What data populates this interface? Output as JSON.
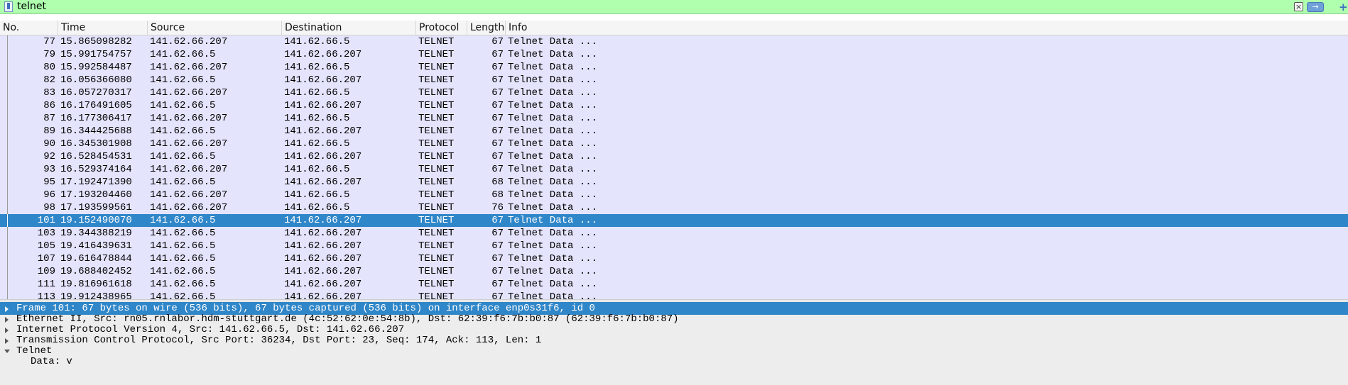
{
  "filter": {
    "value": "telnet",
    "clear_label": "×",
    "apply_label": "→",
    "add_label": "+"
  },
  "columns": [
    "No.",
    "Time",
    "Source",
    "Destination",
    "Protocol",
    "Length",
    "Info"
  ],
  "packets": [
    {
      "no": "77",
      "time": "15.865098282",
      "src": "141.62.66.207",
      "dst": "141.62.66.5",
      "proto": "TELNET",
      "len": "67",
      "info": "Telnet Data ..."
    },
    {
      "no": "79",
      "time": "15.991754757",
      "src": "141.62.66.5",
      "dst": "141.62.66.207",
      "proto": "TELNET",
      "len": "67",
      "info": "Telnet Data ..."
    },
    {
      "no": "80",
      "time": "15.992584487",
      "src": "141.62.66.207",
      "dst": "141.62.66.5",
      "proto": "TELNET",
      "len": "67",
      "info": "Telnet Data ..."
    },
    {
      "no": "82",
      "time": "16.056366080",
      "src": "141.62.66.5",
      "dst": "141.62.66.207",
      "proto": "TELNET",
      "len": "67",
      "info": "Telnet Data ..."
    },
    {
      "no": "83",
      "time": "16.057270317",
      "src": "141.62.66.207",
      "dst": "141.62.66.5",
      "proto": "TELNET",
      "len": "67",
      "info": "Telnet Data ..."
    },
    {
      "no": "86",
      "time": "16.176491605",
      "src": "141.62.66.5",
      "dst": "141.62.66.207",
      "proto": "TELNET",
      "len": "67",
      "info": "Telnet Data ..."
    },
    {
      "no": "87",
      "time": "16.177306417",
      "src": "141.62.66.207",
      "dst": "141.62.66.5",
      "proto": "TELNET",
      "len": "67",
      "info": "Telnet Data ..."
    },
    {
      "no": "89",
      "time": "16.344425688",
      "src": "141.62.66.5",
      "dst": "141.62.66.207",
      "proto": "TELNET",
      "len": "67",
      "info": "Telnet Data ..."
    },
    {
      "no": "90",
      "time": "16.345301908",
      "src": "141.62.66.207",
      "dst": "141.62.66.5",
      "proto": "TELNET",
      "len": "67",
      "info": "Telnet Data ..."
    },
    {
      "no": "92",
      "time": "16.528454531",
      "src": "141.62.66.5",
      "dst": "141.62.66.207",
      "proto": "TELNET",
      "len": "67",
      "info": "Telnet Data ..."
    },
    {
      "no": "93",
      "time": "16.529374164",
      "src": "141.62.66.207",
      "dst": "141.62.66.5",
      "proto": "TELNET",
      "len": "67",
      "info": "Telnet Data ..."
    },
    {
      "no": "95",
      "time": "17.192471390",
      "src": "141.62.66.5",
      "dst": "141.62.66.207",
      "proto": "TELNET",
      "len": "68",
      "info": "Telnet Data ..."
    },
    {
      "no": "96",
      "time": "17.193204460",
      "src": "141.62.66.207",
      "dst": "141.62.66.5",
      "proto": "TELNET",
      "len": "68",
      "info": "Telnet Data ..."
    },
    {
      "no": "98",
      "time": "17.193599561",
      "src": "141.62.66.207",
      "dst": "141.62.66.5",
      "proto": "TELNET",
      "len": "76",
      "info": "Telnet Data ..."
    },
    {
      "no": "101",
      "time": "19.152490070",
      "src": "141.62.66.5",
      "dst": "141.62.66.207",
      "proto": "TELNET",
      "len": "67",
      "info": "Telnet Data ...",
      "selected": true
    },
    {
      "no": "103",
      "time": "19.344388219",
      "src": "141.62.66.5",
      "dst": "141.62.66.207",
      "proto": "TELNET",
      "len": "67",
      "info": "Telnet Data ..."
    },
    {
      "no": "105",
      "time": "19.416439631",
      "src": "141.62.66.5",
      "dst": "141.62.66.207",
      "proto": "TELNET",
      "len": "67",
      "info": "Telnet Data ..."
    },
    {
      "no": "107",
      "time": "19.616478844",
      "src": "141.62.66.5",
      "dst": "141.62.66.207",
      "proto": "TELNET",
      "len": "67",
      "info": "Telnet Data ..."
    },
    {
      "no": "109",
      "time": "19.688402452",
      "src": "141.62.66.5",
      "dst": "141.62.66.207",
      "proto": "TELNET",
      "len": "67",
      "info": "Telnet Data ..."
    },
    {
      "no": "111",
      "time": "19.816961618",
      "src": "141.62.66.5",
      "dst": "141.62.66.207",
      "proto": "TELNET",
      "len": "67",
      "info": "Telnet Data ..."
    },
    {
      "no": "113",
      "time": "19.912438965",
      "src": "141.62.66.5",
      "dst": "141.62.66.207",
      "proto": "TELNET",
      "len": "67",
      "info": "Telnet Data ..."
    }
  ],
  "details": [
    {
      "text": "Frame 101: 67 bytes on wire (536 bits), 67 bytes captured (536 bits) on interface enp0s31f6, id 0",
      "state": "collapsed",
      "selected": true
    },
    {
      "text": "Ethernet II, Src: rn05.rnlabor.hdm-stuttgart.de (4c:52:62:0e:54:8b), Dst: 62:39:f6:7b:b0:87 (62:39:f6:7b:b0:87)",
      "state": "collapsed"
    },
    {
      "text": "Internet Protocol Version 4, Src: 141.62.66.5, Dst: 141.62.66.207",
      "state": "collapsed"
    },
    {
      "text": "Transmission Control Protocol, Src Port: 36234, Dst Port: 23, Seq: 174, Ack: 113, Len: 1",
      "state": "collapsed"
    },
    {
      "text": "Telnet",
      "state": "expanded"
    },
    {
      "text": "Data: v",
      "state": "child"
    }
  ],
  "colors": {
    "filter_valid_bg": "#afffaf",
    "row_bg": "#e4e4fc",
    "selected_bg": "#2f86c8"
  }
}
